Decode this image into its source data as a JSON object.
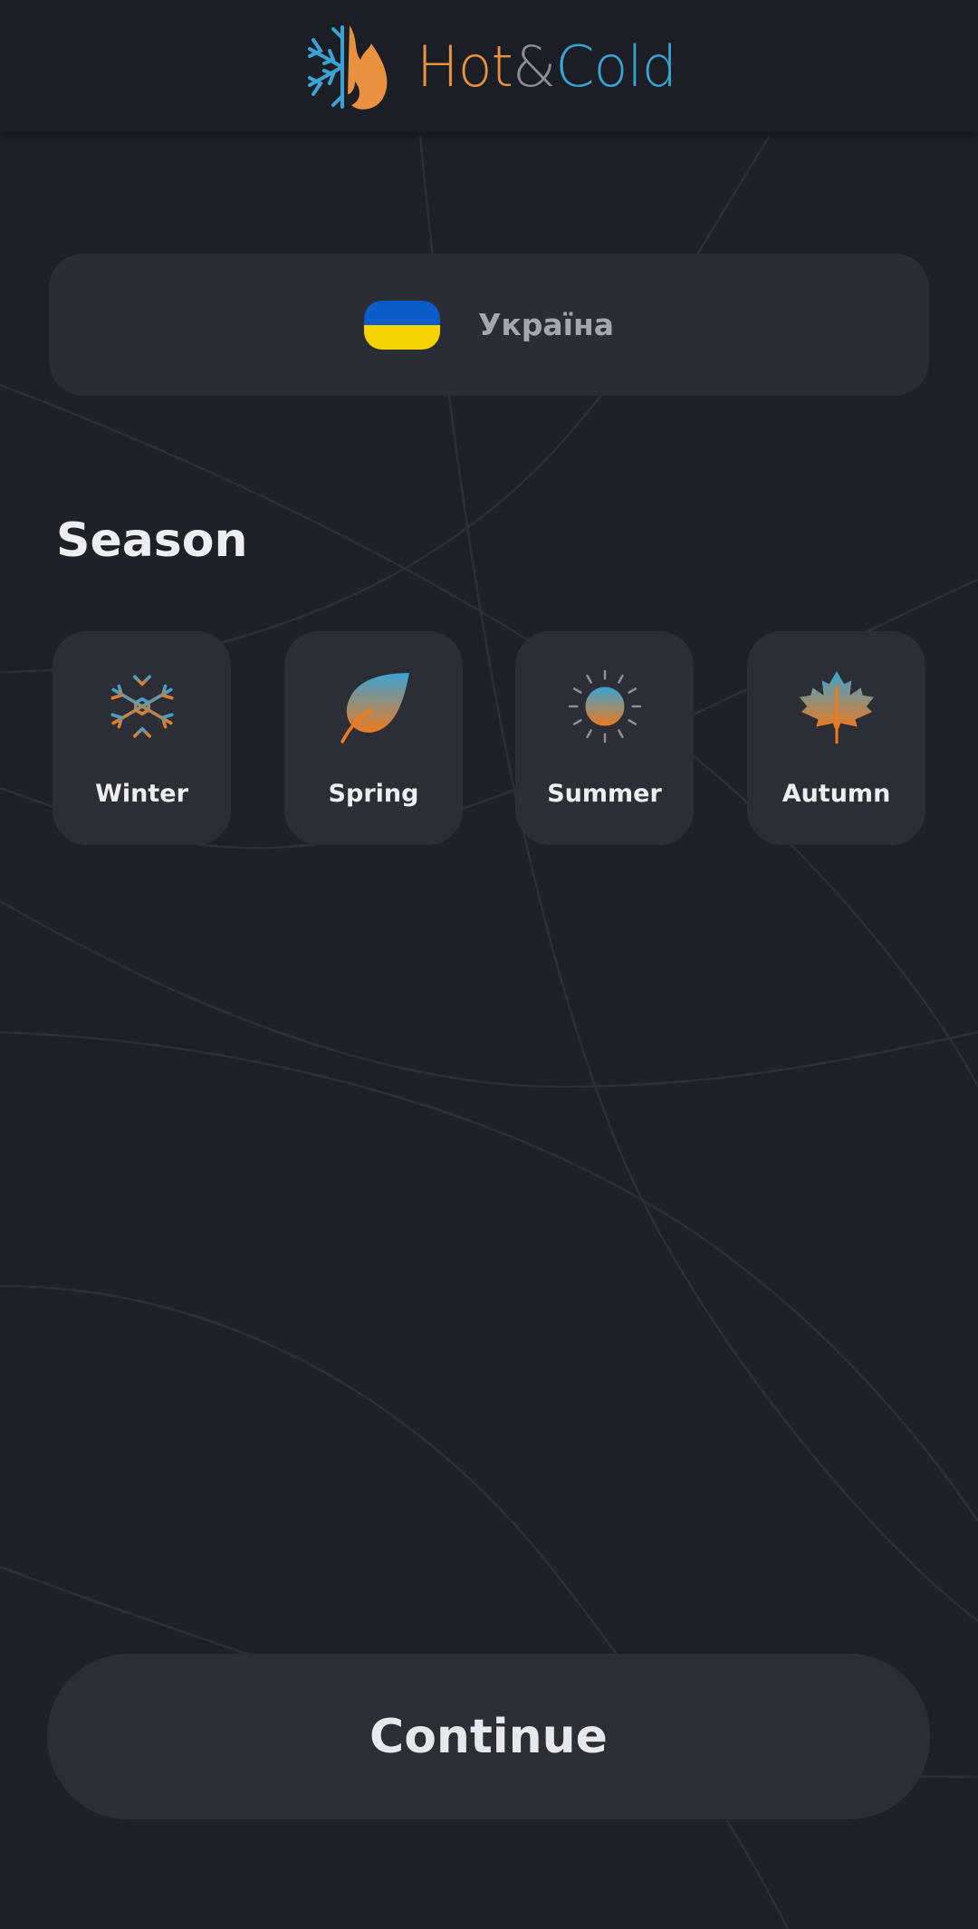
{
  "app": {
    "name_hot": "Hot",
    "name_amp": "&",
    "name_cold": "Cold"
  },
  "language": {
    "label": "Україна",
    "flag": "ukraine-flag",
    "flag_colors": [
      "#0b5bc8",
      "#f6d200"
    ]
  },
  "season_section": {
    "title": "Season",
    "options": [
      {
        "label": "Winter",
        "icon": "snowflake-icon"
      },
      {
        "label": "Spring",
        "icon": "leaf-icon"
      },
      {
        "label": "Summer",
        "icon": "sun-icon"
      },
      {
        "label": "Autumn",
        "icon": "maple-leaf-icon"
      }
    ]
  },
  "actions": {
    "continue_label": "Continue"
  },
  "colors": {
    "background": "#1f2129",
    "card": "#2c2e36",
    "hot_accent": "#e8913f",
    "cold_accent": "#3aa3d3"
  }
}
